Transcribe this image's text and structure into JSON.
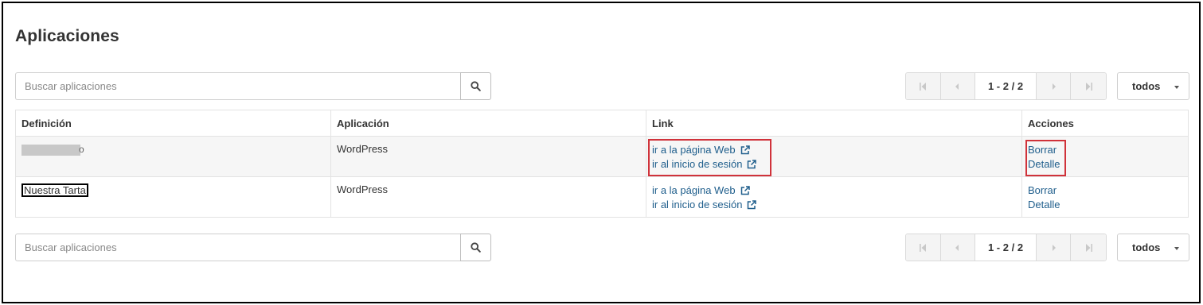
{
  "page": {
    "title": "Aplicaciones"
  },
  "search": {
    "placeholder": "Buscar aplicaciones"
  },
  "pagination": {
    "range": "1 - 2 / 2",
    "page_size": "todos"
  },
  "table": {
    "headers": [
      "Definición",
      "Aplicación",
      "Link",
      "Acciones"
    ],
    "rows": [
      {
        "definition": "",
        "definition_visible_tail": "o",
        "application": "WordPress",
        "link_web": "ir a la página Web",
        "link_login": "ir al inicio de sesión",
        "action_delete": "Borrar",
        "action_detail": "Detalle"
      },
      {
        "definition": "Nuestra Tarta",
        "application": "WordPress",
        "link_web": "ir a la página Web",
        "link_login": "ir al inicio de sesión",
        "action_delete": "Borrar",
        "action_detail": "Detalle"
      }
    ]
  },
  "colors": {
    "link": "#1f5e8c",
    "highlight": "#d0323a",
    "row_alt": "#f6f6f6"
  },
  "icons": [
    "search-icon",
    "first-page-icon",
    "prev-page-icon",
    "next-page-icon",
    "last-page-icon",
    "caret-down-icon",
    "external-link-icon"
  ]
}
